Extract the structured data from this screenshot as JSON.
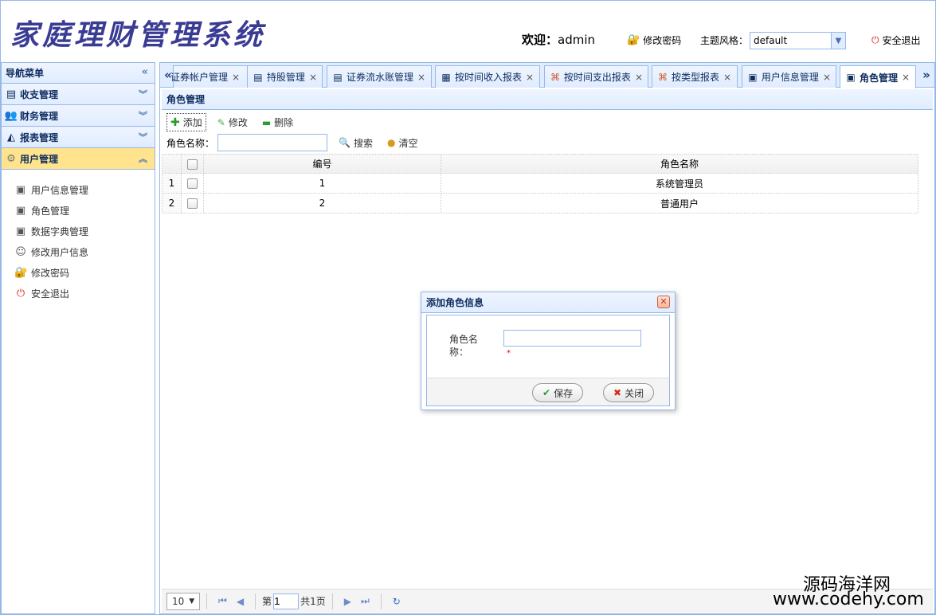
{
  "header": {
    "logo_text": "家庭理财管理系统",
    "welcome_label": "欢迎：",
    "username": "admin",
    "change_password": "修改密码",
    "theme_label": "主题风格：",
    "theme_value": "default",
    "logout": "安全退出"
  },
  "sidebar": {
    "title": "导航菜单",
    "sections": [
      {
        "label": "收支管理"
      },
      {
        "label": "财务管理"
      },
      {
        "label": "报表管理"
      },
      {
        "label": "用户管理"
      }
    ],
    "items": [
      {
        "label": "用户信息管理"
      },
      {
        "label": "角色管理"
      },
      {
        "label": "数据字典管理"
      },
      {
        "label": "修改用户信息"
      },
      {
        "label": "修改密码"
      },
      {
        "label": "安全退出"
      }
    ]
  },
  "tabs": [
    {
      "label": "证券帐户管理"
    },
    {
      "label": "持股管理"
    },
    {
      "label": "证券流水账管理"
    },
    {
      "label": "按时间收入报表"
    },
    {
      "label": "按时间支出报表"
    },
    {
      "label": "按类型报表"
    },
    {
      "label": "用户信息管理"
    },
    {
      "label": "角色管理"
    }
  ],
  "tab_close": "×",
  "panel": {
    "title": "角色管理",
    "toolbar": {
      "add": "添加",
      "edit": "修改",
      "delete": "删除"
    },
    "search": {
      "label": "角色名称：",
      "search_btn": "搜索",
      "clear_btn": "清空"
    }
  },
  "grid": {
    "columns": [
      "编号",
      "角色名称"
    ],
    "rows": [
      {
        "rownum": "1",
        "id": "1",
        "name": "系统管理员"
      },
      {
        "rownum": "2",
        "id": "2",
        "name": "普通用户"
      }
    ]
  },
  "pager": {
    "page_size": "10",
    "page_prefix": "第",
    "page_value": "1",
    "page_total": "共1页"
  },
  "dialog": {
    "title": "添加角色信息",
    "field_label": "角色名称：",
    "required_mark": "*",
    "save": "保存",
    "close": "关闭"
  },
  "watermark": {
    "line1": "源码海洋网",
    "line2": "www.codehy.com"
  },
  "colors": {
    "logo": "#3a3b93",
    "border": "#95b8e7",
    "header_bg": "#e0ecff",
    "active_section": "#ffe48d"
  }
}
